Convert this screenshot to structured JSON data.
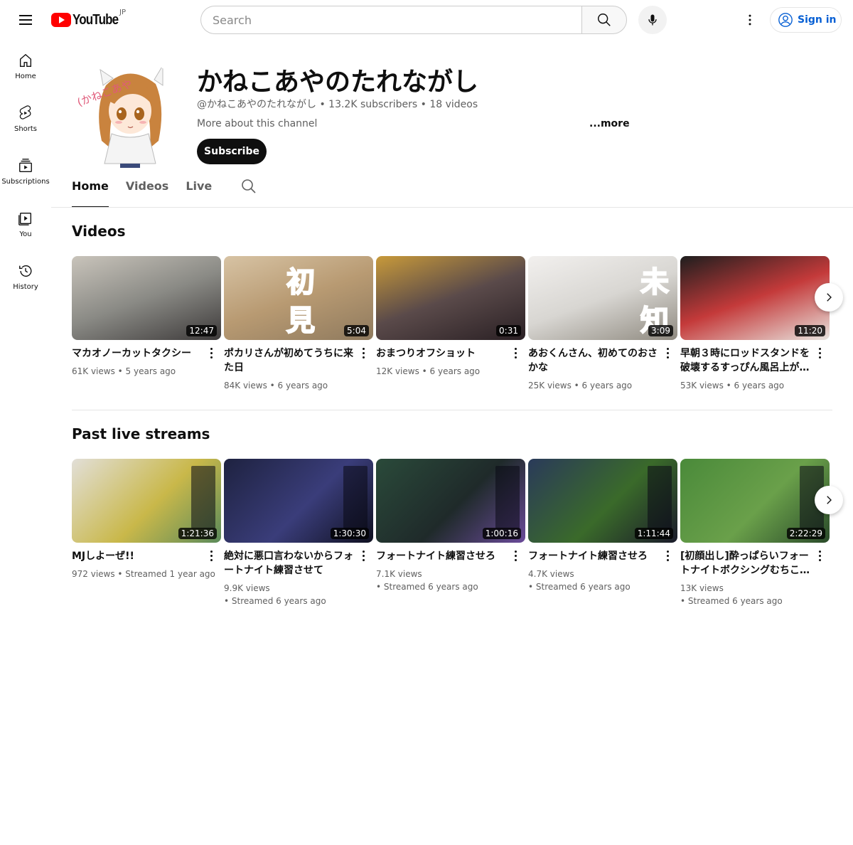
{
  "header": {
    "logo_text": "YouTube",
    "country": "JP",
    "search_placeholder": "Search",
    "signin_label": "Sign in"
  },
  "sidebar": {
    "items": [
      {
        "label": "Home",
        "icon": "home-icon"
      },
      {
        "label": "Shorts",
        "icon": "shorts-icon"
      },
      {
        "label": "Subscriptions",
        "icon": "subscriptions-icon"
      },
      {
        "label": "You",
        "icon": "you-icon"
      },
      {
        "label": "History",
        "icon": "history-icon"
      }
    ]
  },
  "channel": {
    "name": "かねこあやのたれながし",
    "meta": "@かねこあやのたれながし • 13.2K subscribers • 18 videos",
    "about": "More about this channel",
    "more": "...more",
    "subscribe_label": "Subscribe"
  },
  "tabs": [
    {
      "label": "Home",
      "active": true
    },
    {
      "label": "Videos",
      "active": false
    },
    {
      "label": "Live",
      "active": false
    }
  ],
  "sections": {
    "videos_title": "Videos",
    "live_title": "Past live streams"
  },
  "videos": [
    {
      "title": "マカオノーカットタクシー",
      "meta": "61K views • 5 years ago",
      "duration": "12:47",
      "colors": [
        "#8a8a85",
        "#3d3a3a",
        "#c9c4bb"
      ]
    },
    {
      "title": "ポカリさんが初めてうちに来た日",
      "meta": "84K views • 6 years ago",
      "duration": "5:04",
      "colors": [
        "#b89a72",
        "#8f7a5e",
        "#d7c3a4"
      ],
      "overlay": [
        "初",
        "見"
      ]
    },
    {
      "title": "おまつりオフショット",
      "meta": "12K views • 6 years ago",
      "duration": "0:31",
      "colors": [
        "#5a4a4a",
        "#2a2024",
        "#c89a3a"
      ]
    },
    {
      "title": "あおくんさん、初めてのおさかな",
      "meta": "25K views • 6 years ago",
      "duration": "3:09",
      "colors": [
        "#d8d6d2",
        "#8f8a80",
        "#f2f0ee"
      ],
      "overlay": [
        "未",
        "知"
      ]
    },
    {
      "title": "早朝３時にロッドスタンドを破壊するすっぴん風呂上が…",
      "meta": "53K views • 6 years ago",
      "duration": "11:20",
      "colors": [
        "#c43a3a",
        "#e8e4df",
        "#1e1e1e"
      ]
    }
  ],
  "streams": [
    {
      "title": "MJしよーぜ!!",
      "meta_lines": [
        "972 views • Streamed 1 year ago"
      ],
      "duration": "1:21:36",
      "colors": [
        "#e2dfd8",
        "#c9b84a",
        "#5a8a5a"
      ]
    },
    {
      "title": "絶対に悪口言わないからフォートナイト練習させて",
      "meta_lines": [
        "9.9K views",
        "• Streamed 6 years ago"
      ],
      "duration": "1:30:30",
      "colors": [
        "#1e2240",
        "#3a3d7a",
        "#0f1020"
      ]
    },
    {
      "title": "フォートナイト練習させろ",
      "meta_lines": [
        "7.1K views",
        "• Streamed 6 years ago"
      ],
      "duration": "1:00:16",
      "colors": [
        "#2a4a3a",
        "#1f2a2a",
        "#6a4a9a"
      ]
    },
    {
      "title": "フォートナイト練習させろ",
      "meta_lines": [
        "4.7K views",
        "• Streamed 6 years ago"
      ],
      "duration": "1:11:44",
      "colors": [
        "#2a3a5a",
        "#3a6a2a",
        "#1a1a2a"
      ]
    },
    {
      "title": "[初顔出し]酔っぱらいフォートナイトボクシングむちこ…",
      "meta_lines": [
        "13K views",
        "• Streamed 6 years ago"
      ],
      "duration": "2:22:29",
      "colors": [
        "#4a8a3a",
        "#6aa04a",
        "#2a4a2a"
      ]
    }
  ]
}
